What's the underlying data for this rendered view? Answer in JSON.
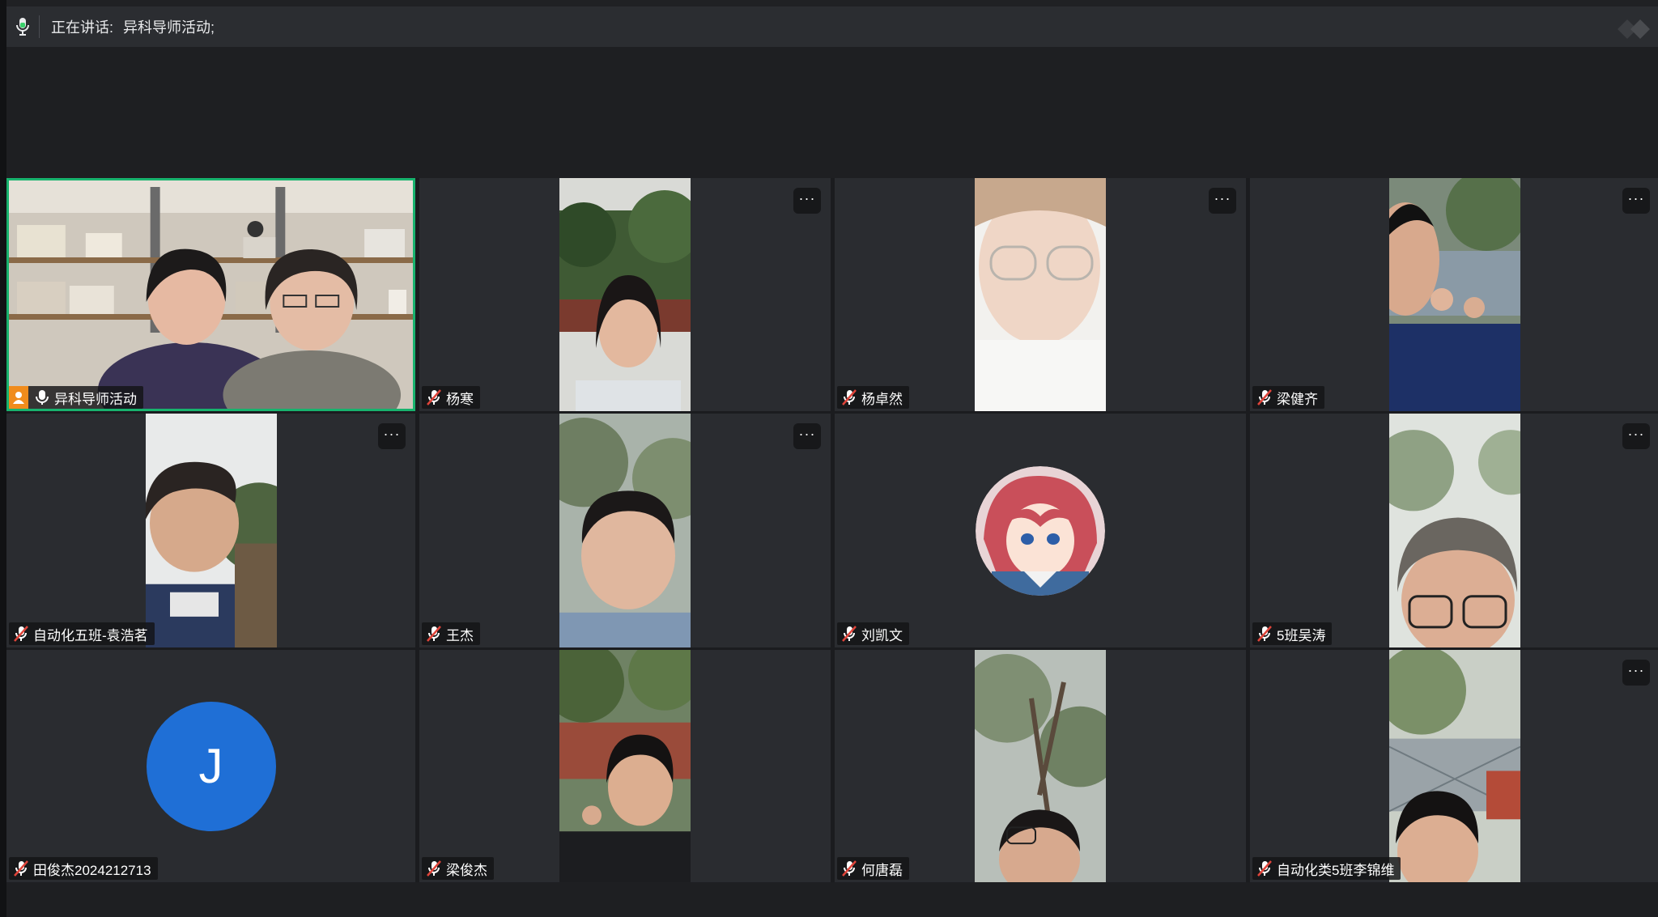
{
  "topbar": {
    "speaking_label": "正在讲话:",
    "speaking_name": "异科导师活动;"
  },
  "participants": [
    {
      "name": "异科导师活动",
      "host": true
    },
    {
      "name": "杨寒"
    },
    {
      "name": "杨卓然"
    },
    {
      "name": "梁健齐"
    },
    {
      "name": "自动化五班-袁浩茗"
    },
    {
      "name": "王杰"
    },
    {
      "name": "刘凯文"
    },
    {
      "name": "5班吴涛"
    },
    {
      "name": "田俊杰2024212713",
      "avatar_letter": "J"
    },
    {
      "name": "梁俊杰"
    },
    {
      "name": "何唐磊"
    },
    {
      "name": "自动化类5班李锦维"
    }
  ],
  "more_label": "···",
  "colors": {
    "active_border": "#18b36e",
    "host_badge": "#f08c1c",
    "avatar_blue": "#1f6fd6",
    "mic_green": "#3ad06b",
    "mute_red": "#e0443a"
  },
  "icons": {
    "mic": "microphone-icon",
    "muted": "mic-muted-icon",
    "more": "more-options-icon",
    "host": "host-person-icon"
  }
}
